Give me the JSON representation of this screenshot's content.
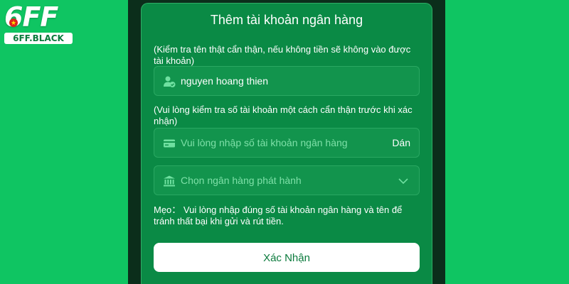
{
  "logo": {
    "main": "6FF",
    "sub": "6FF.BLACK"
  },
  "dialog": {
    "title": "Thêm tài khoản ngân hàng",
    "name_note": "(Kiểm tra tên thật cẩn thận, nếu không tiền sẽ không vào được tài khoản)",
    "name_value": "nguyen hoang thien",
    "account_note": "(Vui lòng kiểm tra số tài khoản một cách cẩn thận trước khi xác nhận)",
    "account_placeholder": "Vui lòng nhập số tài khoản ngân hàng",
    "paste_label": "Dán",
    "bank_placeholder": "Chọn ngân hàng phát hành",
    "tip": "Mẹo： Vui lòng nhập đúng số tài khoản ngân hàng và tên để tránh thất bại khi gửi và rút tiền.",
    "confirm_label": "Xác Nhận"
  },
  "icons": {
    "name_field": "user-check-icon",
    "account_field": "card-icon",
    "bank_field": "bank-icon",
    "dropdown": "chevron-down-icon"
  },
  "colors": {
    "page_bg": "#0fc562",
    "modal_bg": "#0a8a45",
    "field_bg": "#12944d",
    "placeholder": "#7ee0a8",
    "button_text": "#0a7a3c"
  }
}
